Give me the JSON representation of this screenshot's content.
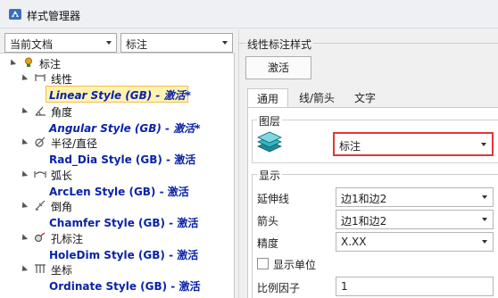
{
  "window": {
    "title": "样式管理器"
  },
  "left": {
    "scope_select": {
      "value": "当前文档"
    },
    "type_select": {
      "value": "标注"
    },
    "tree": {
      "root": "标注",
      "categories": [
        {
          "label": "线性",
          "style": "Linear Style (GB) - 激活*",
          "italic": true,
          "selected": true,
          "icon": "linear-dimension-icon"
        },
        {
          "label": "角度",
          "style": "Angular Style (GB) - 激活*",
          "italic": true,
          "selected": false,
          "icon": "angular-dimension-icon"
        },
        {
          "label": "半径/直径",
          "style": "Rad_Dia Style (GB) - 激活",
          "italic": false,
          "selected": false,
          "icon": "radius-diameter-icon"
        },
        {
          "label": "弧长",
          "style": "ArcLen Style (GB) - 激活",
          "italic": false,
          "selected": false,
          "icon": "arc-length-icon"
        },
        {
          "label": "倒角",
          "style": "Chamfer Style (GB) - 激活",
          "italic": false,
          "selected": false,
          "icon": "chamfer-icon"
        },
        {
          "label": "孔标注",
          "style": "HoleDim Style (GB) - 激活",
          "italic": false,
          "selected": false,
          "icon": "hole-dimension-icon"
        },
        {
          "label": "坐标",
          "style": "Ordinate Style (GB) - 激活",
          "italic": false,
          "selected": false,
          "icon": "ordinate-icon"
        }
      ]
    }
  },
  "right": {
    "section_title": "线性标注样式",
    "activate_button": "激活",
    "tabs": [
      "通用",
      "线/箭头",
      "文字"
    ],
    "active_tab": 0,
    "layer_group": {
      "title": "图层",
      "value": "标注",
      "icon": "layers-icon"
    },
    "display_group": {
      "title": "显示",
      "rows": [
        {
          "label": "延伸线",
          "value": "边1和边2"
        },
        {
          "label": "箭头",
          "value": "边1和边2"
        },
        {
          "label": "精度",
          "value": "X.XX"
        }
      ],
      "show_units": {
        "label": "显示单位",
        "checked": false
      },
      "scale": {
        "label": "比例因子",
        "value": "1"
      }
    }
  },
  "colors": {
    "highlight_border": "#e0373b",
    "style_text": "#0a23a8",
    "selection": "#fff2b3"
  }
}
